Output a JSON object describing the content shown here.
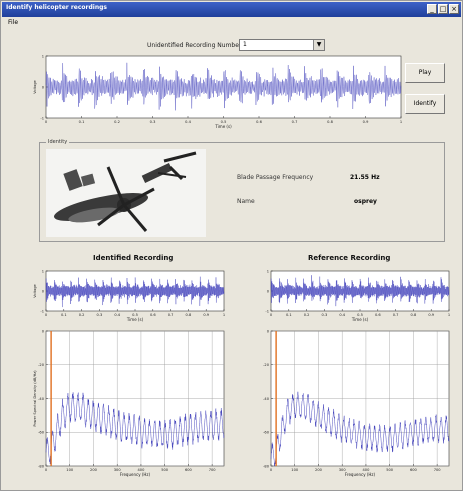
{
  "window": {
    "title": "Identify helicopter recordings",
    "controls": [
      "_",
      "□",
      "×"
    ]
  },
  "menu": {
    "items": [
      "File"
    ]
  },
  "selector": {
    "label": "Unidentified Recording Number",
    "value": "1"
  },
  "buttons": {
    "play": "Play",
    "identify": "Identify"
  },
  "identity": {
    "legend": "Identity",
    "blade_label": "Blade Passage Frequency",
    "blade_value": "21.55 Hz",
    "name_label": "Name",
    "name_value": "osprey"
  },
  "panels": {
    "identified_title": "Identified Recording",
    "reference_title": "Reference Recording"
  },
  "colors": {
    "signal": "#3a3ab8",
    "marker": "#e07020",
    "axes_bg": "#ffffff",
    "window_bg": "#e9e6dc"
  },
  "chart_data": [
    {
      "type": "line",
      "name": "top_waveform",
      "ylabel": "Voltage",
      "xlabel": "Time (s)",
      "xlim": [
        0,
        1
      ],
      "ylim": [
        -1,
        1
      ],
      "xticks": [
        "0",
        "0.1",
        "0.2",
        "0.3",
        "0.4",
        "0.5",
        "0.6",
        "0.7",
        "0.8",
        "0.9",
        "1"
      ],
      "yticks": [
        "1",
        "0",
        "-1"
      ],
      "grid": false,
      "pulses": 22
    },
    {
      "type": "line",
      "name": "identified_waveform",
      "ylabel": "Voltage",
      "xlabel": "Time (s)",
      "xlim": [
        0,
        1
      ],
      "ylim": [
        -1,
        1
      ],
      "xticks": [
        "0",
        "0.1",
        "0.2",
        "0.3",
        "0.4",
        "0.5",
        "0.6",
        "0.7",
        "0.8",
        "0.9",
        "1"
      ],
      "yticks": [
        "1",
        "0",
        "-1"
      ],
      "grid": false,
      "pulses": 22
    },
    {
      "type": "line",
      "name": "reference_waveform",
      "ylabel": "",
      "xlabel": "Time (s)",
      "xlim": [
        0,
        1
      ],
      "ylim": [
        -1,
        1
      ],
      "xticks": [
        "0",
        "0.1",
        "0.2",
        "0.3",
        "0.4",
        "0.5",
        "0.6",
        "0.7",
        "0.8",
        "0.9",
        "1"
      ],
      "yticks": [
        "1",
        "0",
        "-1"
      ],
      "grid": false,
      "pulses": 22
    },
    {
      "type": "line",
      "name": "identified_psd",
      "ylabel": "Power Spectral Density (dB/Hz)",
      "xlabel": "Frequency (Hz)",
      "xlim": [
        0,
        750
      ],
      "ylim": [
        -80,
        0
      ],
      "xticks": [
        "0",
        "100",
        "200",
        "300",
        "400",
        "500",
        "600",
        "700"
      ],
      "yticks": [
        "0",
        "-20",
        "-40",
        "-60",
        "-80"
      ],
      "grid": true,
      "marker_freq": 21.55,
      "envelope": [
        [
          0,
          -72
        ],
        [
          20,
          -70
        ],
        [
          40,
          -62
        ],
        [
          70,
          -50
        ],
        [
          100,
          -45
        ],
        [
          150,
          -46
        ],
        [
          200,
          -50
        ],
        [
          300,
          -56
        ],
        [
          400,
          -60
        ],
        [
          500,
          -62
        ],
        [
          600,
          -58
        ],
        [
          700,
          -56
        ],
        [
          750,
          -55
        ]
      ],
      "spread": 10
    },
    {
      "type": "line",
      "name": "reference_psd",
      "ylabel": "",
      "xlabel": "Frequency (Hz)",
      "xlim": [
        0,
        750
      ],
      "ylim": [
        -80,
        0
      ],
      "xticks": [
        "0",
        "100",
        "200",
        "300",
        "400",
        "500",
        "600",
        "700"
      ],
      "yticks": [
        "0",
        "-20",
        "-40",
        "-60",
        "-80"
      ],
      "grid": true,
      "marker_freq": 21.55,
      "envelope": [
        [
          0,
          -76
        ],
        [
          20,
          -72
        ],
        [
          40,
          -62
        ],
        [
          70,
          -48
        ],
        [
          100,
          -44
        ],
        [
          150,
          -45
        ],
        [
          200,
          -50
        ],
        [
          300,
          -58
        ],
        [
          400,
          -63
        ],
        [
          500,
          -64
        ],
        [
          600,
          -60
        ],
        [
          700,
          -58
        ],
        [
          750,
          -58
        ]
      ],
      "spread": 9
    }
  ]
}
